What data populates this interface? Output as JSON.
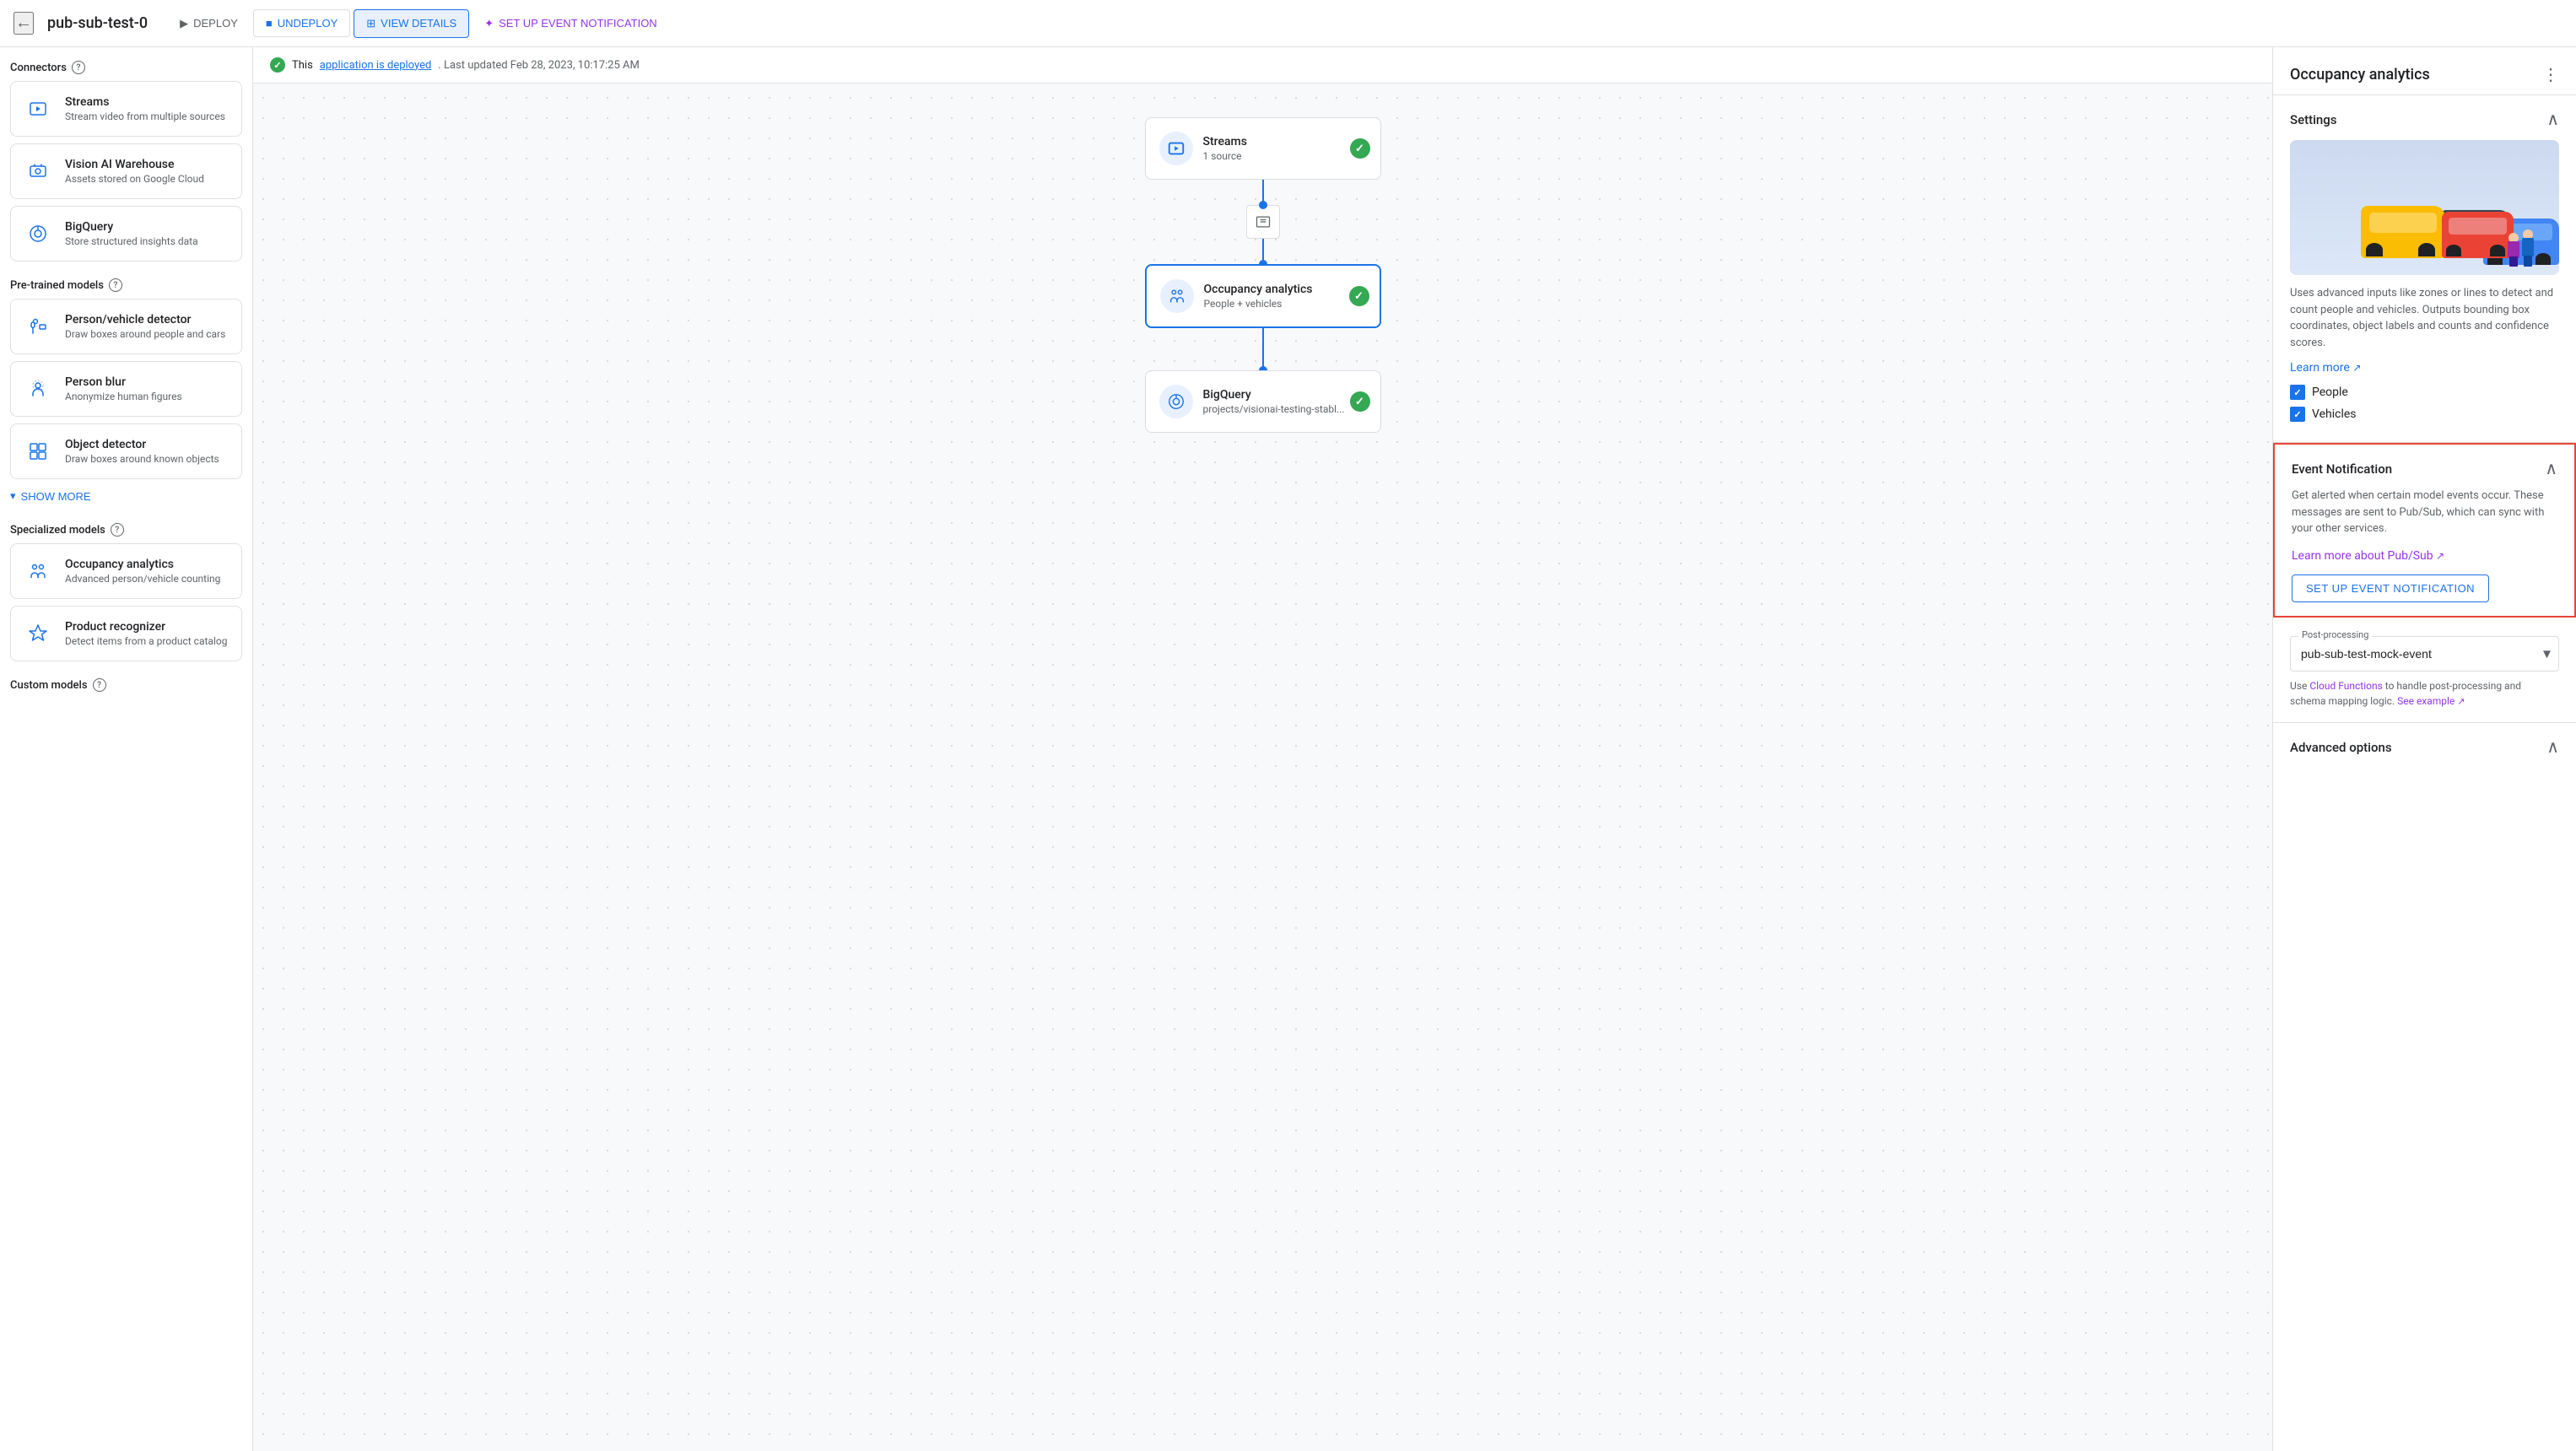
{
  "topbar": {
    "title": "pub-sub-test-0",
    "back_label": "←",
    "deploy_label": "DEPLOY",
    "undeploy_label": "UNDEPLOY",
    "view_details_label": "VIEW DETAILS",
    "setup_event_label": "SET UP EVENT NOTIFICATION"
  },
  "status": {
    "text_prefix": "This",
    "link_text": "application is deployed",
    "text_suffix": ". Last updated Feb 28, 2023, 10:17:25 AM"
  },
  "sidebar": {
    "connectors_title": "Connectors",
    "connectors": [
      {
        "name": "Streams",
        "desc": "Stream video from multiple sources"
      },
      {
        "name": "Vision AI Warehouse",
        "desc": "Assets stored on Google Cloud"
      },
      {
        "name": "BigQuery",
        "desc": "Store structured insights data"
      }
    ],
    "pretrained_title": "Pre-trained models",
    "pretrained": [
      {
        "name": "Person/vehicle detector",
        "desc": "Draw boxes around people and cars"
      },
      {
        "name": "Person blur",
        "desc": "Anonymize human figures"
      },
      {
        "name": "Object detector",
        "desc": "Draw boxes around known objects"
      }
    ],
    "show_more_label": "SHOW MORE",
    "specialized_title": "Specialized models",
    "specialized": [
      {
        "name": "Occupancy analytics",
        "desc": "Advanced person/vehicle counting"
      },
      {
        "name": "Product recognizer",
        "desc": "Detect items from a product catalog"
      }
    ],
    "custom_title": "Custom models"
  },
  "flow": {
    "nodes": [
      {
        "title": "Streams",
        "subtitle": "1 source",
        "type": "streams"
      },
      {
        "title": "Occupancy analytics",
        "subtitle": "People + vehicles",
        "type": "occupancy",
        "selected": true
      },
      {
        "title": "BigQuery",
        "subtitle": "projects/visionai-testing-stabl...",
        "type": "bigquery"
      }
    ]
  },
  "right_panel": {
    "title": "Occupancy analytics",
    "settings_title": "Settings",
    "preview_alt": "Occupancy analytics preview with cars and people",
    "desc": "Uses advanced inputs like zones or lines to detect and count people and vehicles. Outputs bounding box coordinates, object labels and counts and confidence scores.",
    "learn_more_label": "Learn more",
    "checkboxes": [
      {
        "label": "People",
        "checked": true
      },
      {
        "label": "Vehicles",
        "checked": true
      }
    ],
    "event_notification": {
      "title": "Event Notification",
      "desc": "Get alerted when certain model events occur. These messages are sent to Pub/Sub, which can sync with your other services.",
      "link_text": "Learn more about Pub/Sub",
      "button_label": "SET UP EVENT NOTIFICATION"
    },
    "post_processing": {
      "label": "Post-processing",
      "value": "pub-sub-test-mock-event",
      "note_prefix": "Use",
      "note_link": "Cloud Functions",
      "note_suffix": "to handle post-processing and schema mapping logic.",
      "see_example_label": "See example"
    },
    "advanced_options": {
      "title": "Advanced options"
    }
  }
}
